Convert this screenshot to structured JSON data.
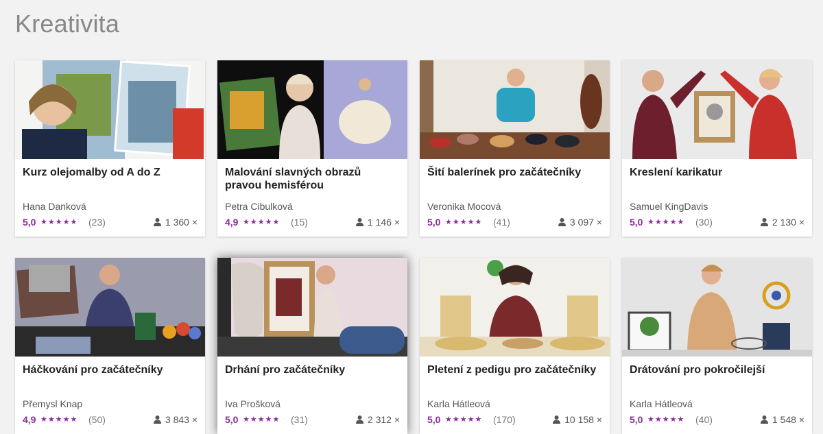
{
  "page": {
    "title": "Kreativita"
  },
  "courses": [
    {
      "title": "Kurz olejomalby od A do Z",
      "author": "Hana Danková",
      "rating": "5,0",
      "stars": "★★★★★",
      "reviews": "(23)",
      "students": "1 360 ×",
      "thumb_colors": [
        "#d9e4ea",
        "#6f8f3d",
        "#c4a68c"
      ]
    },
    {
      "title": "Malování slavných obrazů pravou hemisférou",
      "author": "Petra Cibulková",
      "rating": "4,9",
      "stars": "★★★★★",
      "reviews": "(15)",
      "students": "1 146 ×",
      "thumb_colors": [
        "#101010",
        "#a9a6d8",
        "#d9b18a"
      ]
    },
    {
      "title": "Šití balerínek pro začátečníky",
      "author": "Veronika Mocová",
      "rating": "5,0",
      "stars": "★★★★★",
      "reviews": "(41)",
      "students": "3 097 ×",
      "thumb_colors": [
        "#e9e4dc",
        "#2a9db5",
        "#6b3a2a"
      ]
    },
    {
      "title": "Kreslení karikatur",
      "author": "Samuel KingDavis",
      "rating": "5,0",
      "stars": "★★★★★",
      "reviews": "(30)",
      "students": "2 130 ×",
      "thumb_colors": [
        "#ececec",
        "#7a1f2e",
        "#c9302c"
      ]
    },
    {
      "title": "Háčkování pro začátečníky",
      "author": "Přemysl Knap",
      "rating": "4,9",
      "stars": "★★★★★",
      "reviews": "(50)",
      "students": "3 843 ×",
      "thumb_colors": [
        "#8a8aa0",
        "#3b3f6b",
        "#2b2b2b"
      ]
    },
    {
      "title": "Drhání pro začátečníky",
      "author": "Iva Prošková",
      "rating": "5,0",
      "stars": "★★★★★",
      "reviews": "(31)",
      "students": "2 312 ×",
      "thumb_colors": [
        "#e6d7dc",
        "#b8925a",
        "#3d5a8c"
      ]
    },
    {
      "title": "Pletení z pedigu pro začátečníky",
      "author": "Karla Hátleová",
      "rating": "5,0",
      "stars": "★★★★★",
      "reviews": "(170)",
      "students": "10 158 ×",
      "thumb_colors": [
        "#f1f0e8",
        "#d9b870",
        "#7a2a2a"
      ]
    },
    {
      "title": "Drátování pro pokročilejší",
      "author": "Karla Hátleová",
      "rating": "5,0",
      "stars": "★★★★★",
      "reviews": "(40)",
      "students": "1 548 ×",
      "thumb_colors": [
        "#e5e5e5",
        "#d8a06a",
        "#3a4a6a"
      ]
    }
  ],
  "icons": {
    "students": "person-icon",
    "rating": "star-icon"
  },
  "colors": {
    "accent": "#8a2b9c",
    "background": "#f2f2f2",
    "title": "#888888"
  }
}
